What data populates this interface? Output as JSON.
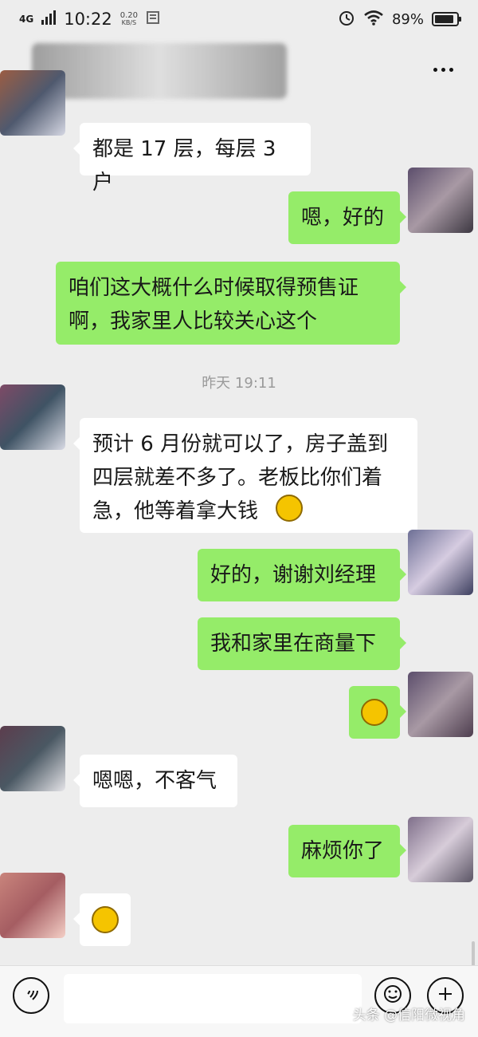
{
  "status_bar": {
    "network": "4G",
    "time": "10:22",
    "speed_value": "0.20",
    "speed_unit": "KB/S",
    "battery": "89%",
    "battery_level": 0.89
  },
  "messages": {
    "m1": "都是 17 层，每层 3 户",
    "m2": "嗯，好的",
    "m3": "咱们这大概什么时候取得预售证啊，我家里人比较关心这个",
    "timestamp": "昨天 19:11",
    "m4": "预计 6 月份就可以了，房子盖到四层就差不多了。老板比你们着急，他等着拿大钱",
    "m5": "好的，谢谢刘经理",
    "m6": "我和家里在商量下",
    "m8": "嗯嗯，不客气",
    "m9": "麻烦你了"
  },
  "watermark": "头条 @信阳微视角",
  "icons": {
    "more": "more-icon",
    "voice": "voice-icon",
    "emoji": "emoji-icon",
    "plus": "plus-icon",
    "wifi": "wifi-icon",
    "alarm": "alarm-icon",
    "signal": "signal-icon",
    "battery": "battery-icon"
  },
  "colors": {
    "background": "#ededed",
    "outgoing_bubble": "#95ec69",
    "incoming_bubble": "#ffffff",
    "timestamp": "#9a9a9a"
  }
}
